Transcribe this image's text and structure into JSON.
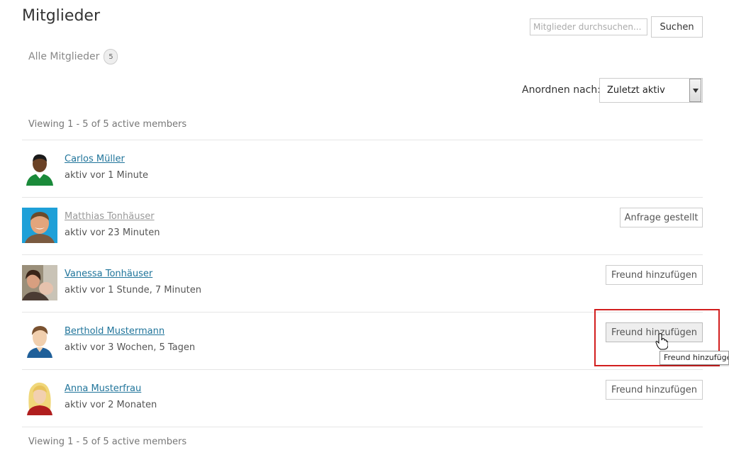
{
  "page": {
    "title": "Mitglieder"
  },
  "search": {
    "placeholder": "Mitglieder durchsuchen...",
    "button_label": "Suchen"
  },
  "tabs": {
    "all_label": "Alle Mitglieder",
    "all_count": "5"
  },
  "order": {
    "label": "Anordnen nach:",
    "selected": "Zuletzt aktiv"
  },
  "pagination": {
    "top": "Viewing 1 - 5 of 5 active members",
    "bottom": "Viewing 1 - 5 of 5 active members"
  },
  "members": [
    {
      "name": "Carlos Müller",
      "activity": "aktiv vor 1 Minute",
      "button": ""
    },
    {
      "name": "Matthias Tonhäuser",
      "activity": "aktiv vor 23 Minuten",
      "button": "Anfrage gestellt"
    },
    {
      "name": "Vanessa Tonhäuser",
      "activity": "aktiv vor 1 Stunde, 7 Minuten",
      "button": "Freund hinzufügen"
    },
    {
      "name": "Berthold Mustermann",
      "activity": "aktiv vor 3 Wochen, 5 Tagen",
      "button": "Freund hinzufügen"
    },
    {
      "name": "Anna Musterfrau",
      "activity": "aktiv vor 2 Monaten",
      "button": "Freund hinzufügen"
    }
  ],
  "tooltip": {
    "text": "Freund hinzufügen"
  },
  "colors": {
    "link": "#21759b",
    "highlight": "#d21f1f"
  }
}
